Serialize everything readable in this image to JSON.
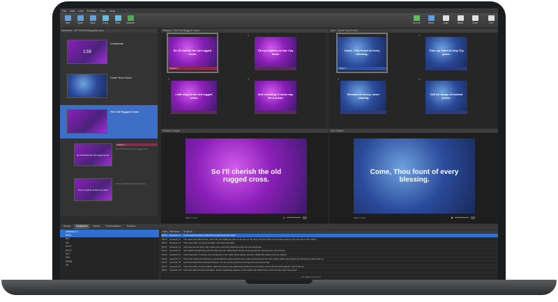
{
  "menu": [
    "File",
    "Edit",
    "Live",
    "Profiles",
    "View",
    "Help"
  ],
  "toolbar_left": [
    {
      "label": "New",
      "color": "#5fa0e0",
      "icon": "new-doc-icon"
    },
    {
      "label": "Open",
      "color": "#5fa0e0",
      "icon": "folder-icon"
    },
    {
      "label": "Save",
      "color": "#5fa0e0",
      "icon": "save-icon"
    },
    {
      "label": "Song",
      "color": "#60c0e0",
      "icon": "music-icon"
    },
    {
      "label": "Bible",
      "color": "#60c0e0",
      "icon": "book-icon"
    },
    {
      "label": "Network",
      "color": "#4ab04a",
      "icon": "network-icon"
    }
  ],
  "toolbar_right": [
    {
      "label": "Go Live",
      "color": "#58c058",
      "icon": "screen-icon"
    },
    {
      "label": "Alerts",
      "color": "#5fa0e0",
      "icon": "alert-icon"
    },
    {
      "label": "Logo",
      "color": "#e0e0e0",
      "icon": "logo-icon"
    },
    {
      "label": "Black",
      "color": "#e0e0e0",
      "icon": "black-icon"
    },
    {
      "label": "Clear",
      "color": "#e0e0e0",
      "icon": "clear-icon"
    },
    {
      "label": "Exit",
      "color": "#e0e0e0",
      "icon": "exit-icon"
    }
  ],
  "schedule": {
    "title": "Schedule - OP 7/3/19 Infographic.json",
    "items": [
      {
        "title": "Countdown",
        "sub": "",
        "thumb": "1:59"
      },
      {
        "title": "Come Thou Fount",
        "sub": "",
        "thumb": ""
      },
      {
        "title": "The Old Rugged Cross",
        "sub": "",
        "thumb": ""
      }
    ],
    "sub_slides": [
      {
        "tag": "Chorus 1",
        "text": "So I'll cherish the old rugged cross."
      },
      {
        "tag": "",
        "text": "Till my trophies at last I lay down"
      }
    ]
  },
  "preview": {
    "title": "Preview - The Old Rugged Cross",
    "slides": [
      {
        "num": "",
        "text": "So I'll cherish the old rugged cross.",
        "bar": "Chorus 1"
      },
      {
        "num": "2",
        "text": "Till my trophies at last I lay down",
        "bar": ""
      },
      {
        "num": "3",
        "text": "I will cling to the old rugged cross",
        "bar": ""
      },
      {
        "num": "4",
        "text": "And exchange it some day for a crown",
        "bar": ""
      }
    ],
    "output_title": "Preview Output",
    "output_text": "So I'll cherish the old rugged cross.",
    "slide_counter": "Slide 1 of 13"
  },
  "live": {
    "title": "Live - Come Thou Fount",
    "slides": [
      {
        "num": "",
        "text": "Come, Thou fount of every blessing.",
        "bar": "Verse 1"
      },
      {
        "num": "2",
        "text": "Tune my heart to sing Thy grace.",
        "bar": ""
      },
      {
        "num": "3",
        "text": "Streams of mercy, never ceasing",
        "bar": ""
      },
      {
        "num": "4",
        "text": "Call for songs of loudest praise.",
        "bar": ""
      }
    ],
    "output_title": "Live Output",
    "output_text": "Come, Thou fount of every blessing.",
    "slide_counter": "Slide 1 of 12"
  },
  "bottom": {
    "tabs": [
      "Songs",
      "Scriptures",
      "Media",
      "Presentations",
      "Themes"
    ],
    "active_tab": "Scriptures",
    "search_value": "Genesis 1:1",
    "versions": [
      "NKJV",
      "NET",
      "NIV",
      "NIV-E",
      "NIV-G",
      "NVT",
      "RVA",
      "SPRM",
      "TB"
    ],
    "table_headers": [
      "Trans.",
      "Reference",
      "Scripture"
    ],
    "rows": [
      {
        "t": "NKJV",
        "r": "Genesis 1:1",
        "s": "In the beginning God created the heavens and the earth."
      },
      {
        "t": "NKJV",
        "r": "Genesis 1:2",
        "s": "The earth was without form, and void; and darkness was on the face of the deep. And the Spirit of God was hovering over the face of the waters."
      },
      {
        "t": "NKJV",
        "r": "Genesis 1:3",
        "s": "Then God said, \"Let there be light\"; and there was light."
      },
      {
        "t": "NKJV",
        "r": "Genesis 1:4",
        "s": "And God saw the light, that it was good; and God divided the light from the darkness."
      },
      {
        "t": "NKJV",
        "r": "Genesis 1:5",
        "s": "God called the light Day, and the darkness He called Night. So the evening and the morning were the first day."
      },
      {
        "t": "NKJV",
        "r": "Genesis 1:6",
        "s": "Then God said, \"Let there be a firmament in the midst of the waters, and let it divide the waters from the waters.\""
      },
      {
        "t": "NKJV",
        "r": "Genesis 1:7",
        "s": "Thus God made the firmament, and divided the waters which were under the firmament from the waters which were above the firmament; and it was so."
      },
      {
        "t": "NKJV",
        "r": "Genesis 1:8",
        "s": "And God called the firmament Heaven. So the evening and the morning were the second day."
      },
      {
        "t": "NKJV",
        "r": "Genesis 1:9",
        "s": "Then God said, \"Let the waters under the heavens be gathered together into one place, and let the dry land appear\"; and it was so."
      },
      {
        "t": "NKJV",
        "r": "Genesis 1:10",
        "s": "And God called the dry land Earth, and the gathering together of the waters He called Seas. And God saw that it was good."
      }
    ],
    "count": "1 of 31102 references"
  }
}
